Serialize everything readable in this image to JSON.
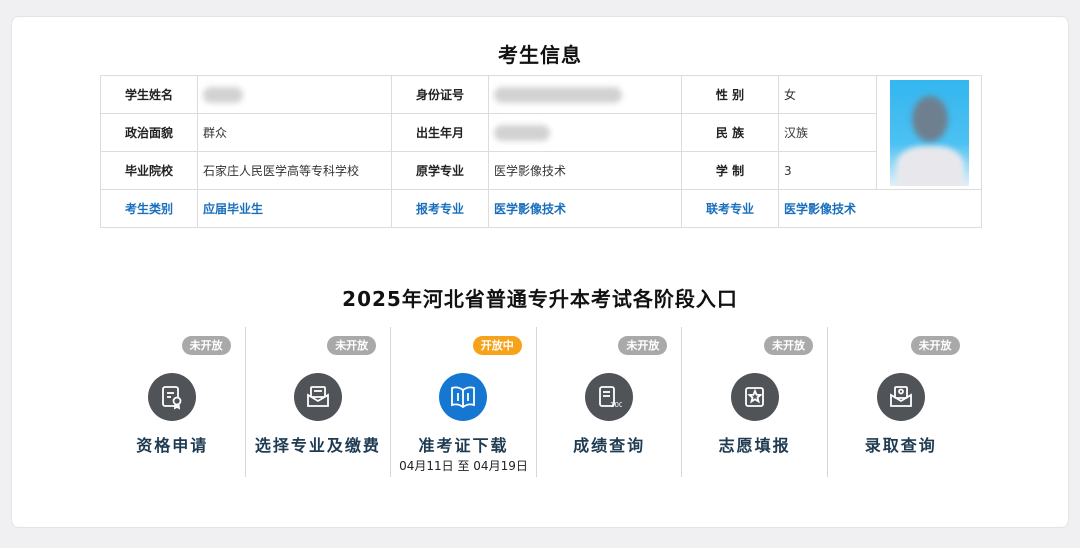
{
  "info": {
    "title": "考生信息",
    "rows": [
      {
        "l1": "学生姓名",
        "v1": "",
        "l2": "身份证号",
        "v2": "",
        "l3": "性 别",
        "v3": "女"
      },
      {
        "l1": "政治面貌",
        "v1": "群众",
        "l2": "出生年月",
        "v2": "",
        "l3": "民 族",
        "v3": "汉族"
      },
      {
        "l1": "毕业院校",
        "v1": "石家庄人民医学高等专科学校",
        "l2": "原学专业",
        "v2": "医学影像技术",
        "l3": "学 制",
        "v3": "3"
      },
      {
        "l1": "考生类别",
        "v1": "应届毕业生",
        "l2": "报考专业",
        "v2": "医学影像技术",
        "l3": "联考专业",
        "v3": "医学影像技术"
      }
    ]
  },
  "section_title": "2025年河北省普通专升本考试各阶段入口",
  "stages": [
    {
      "name": "资格申请",
      "status": "未开放",
      "icon": "certificate-icon",
      "date": ""
    },
    {
      "name": "选择专业及缴费",
      "status": "未开放",
      "icon": "envelope-payment-icon",
      "date": ""
    },
    {
      "name": "准考证下载",
      "status": "开放中",
      "icon": "open-book-icon",
      "date": "04月11日 至 04月19日"
    },
    {
      "name": "成绩查询",
      "status": "未开放",
      "icon": "score-sheet-icon",
      "date": ""
    },
    {
      "name": "志愿填报",
      "status": "未开放",
      "icon": "star-form-icon",
      "date": ""
    },
    {
      "name": "录取查询",
      "status": "未开放",
      "icon": "admission-letter-icon",
      "date": ""
    }
  ],
  "colors": {
    "active": "#1677d2",
    "open_badge": "#f6a21a",
    "closed_badge": "#a9a9a9",
    "link_blue": "#1a6fbd"
  }
}
